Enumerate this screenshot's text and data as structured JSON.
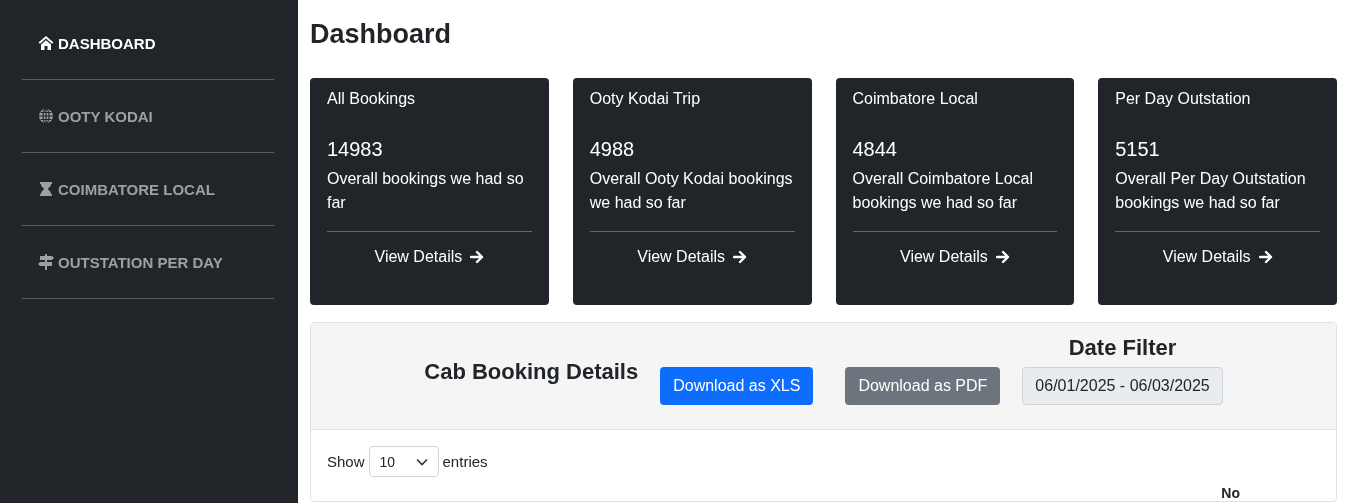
{
  "sidebar": {
    "items": [
      {
        "label": "DASHBOARD",
        "selected": true
      },
      {
        "label": "OOTY KODAI",
        "selected": false
      },
      {
        "label": "COIMBATORE LOCAL",
        "selected": false
      },
      {
        "label": "OUTSTATION PER DAY",
        "selected": false
      }
    ]
  },
  "page_title": "Dashboard",
  "cards": [
    {
      "title": "All Bookings",
      "count": "14983",
      "description": "Overall bookings we had so far",
      "link": "View Details"
    },
    {
      "title": "Ooty Kodai Trip",
      "count": "4988",
      "description": "Overall Ooty Kodai bookings we had so far",
      "link": "View Details"
    },
    {
      "title": "Coimbatore Local",
      "count": "4844",
      "description": "Overall Coimbatore Local bookings we had so far",
      "link": "View Details"
    },
    {
      "title": "Per Day Outstation",
      "count": "5151",
      "description": "Overall Per Day Outstation bookings we had so far",
      "link": "View Details"
    }
  ],
  "panel": {
    "title": "Cab Booking Details",
    "buttons": [
      {
        "label": "Download as XLS",
        "kind": "primary"
      },
      {
        "label": "Download as PDF",
        "kind": "secondary"
      }
    ],
    "date_filter": {
      "label": "Date Filter",
      "value": "06/01/2025 - 06/03/2025"
    },
    "length": {
      "before": "Show",
      "value": "10",
      "after": "entries"
    },
    "table": {
      "columns": [
        "No"
      ]
    }
  }
}
